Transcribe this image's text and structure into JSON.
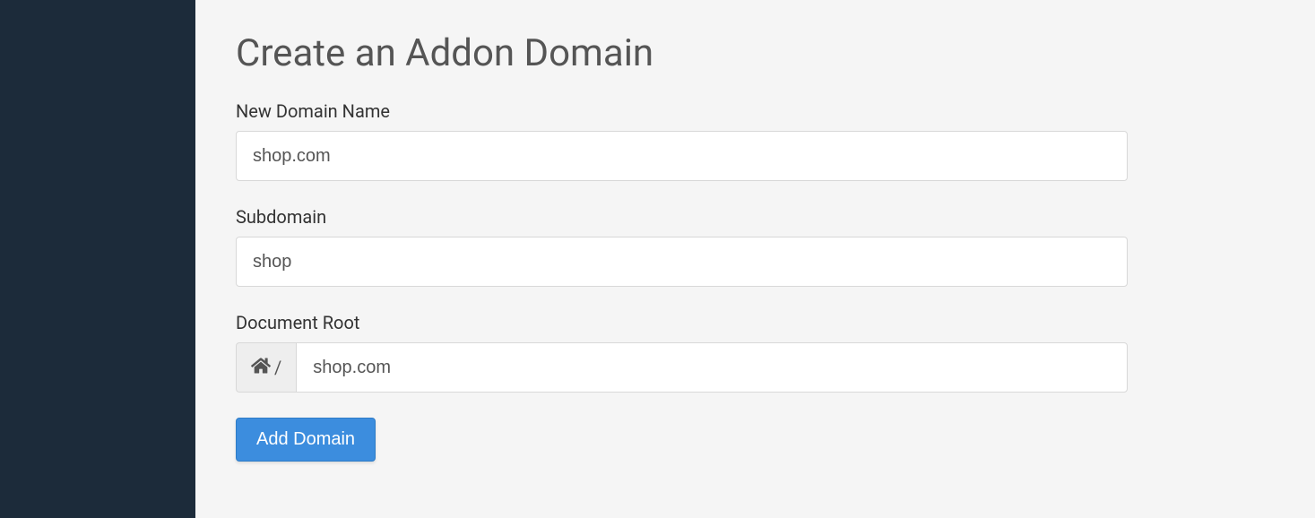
{
  "page": {
    "title": "Create an Addon Domain"
  },
  "form": {
    "newDomainName": {
      "label": "New Domain Name",
      "value": "shop.com"
    },
    "subdomain": {
      "label": "Subdomain",
      "value": "shop"
    },
    "documentRoot": {
      "label": "Document Root",
      "prefix_icon": "home-icon",
      "prefix_separator": "/",
      "value": "shop.com"
    },
    "submit": {
      "label": "Add Domain"
    }
  }
}
